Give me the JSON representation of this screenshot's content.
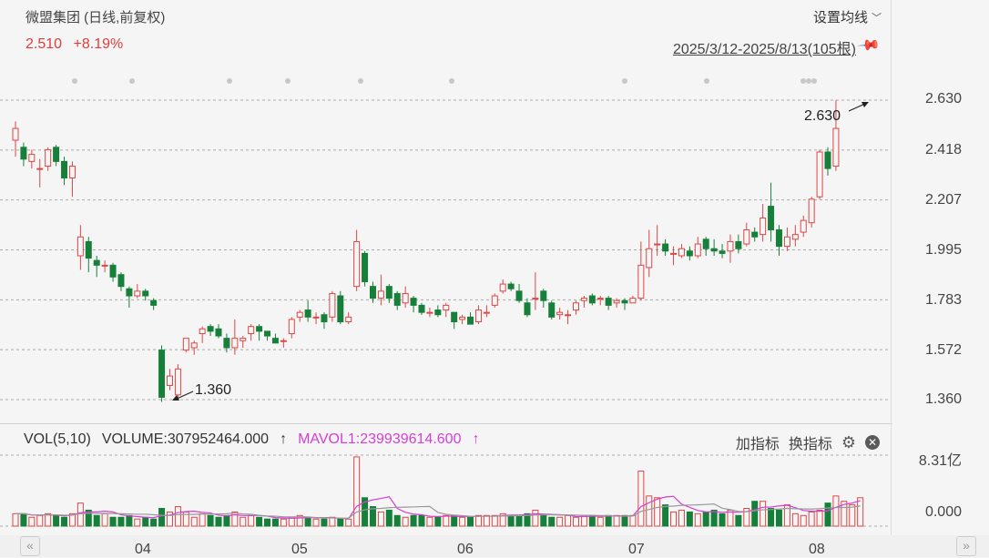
{
  "header": {
    "stock_title": "微盟集团 (日线,前复权)",
    "last_price": "2.510",
    "change_pct": "+8.19%",
    "settings_label": "设置均线",
    "range_label": "2025/3/12-2025/8/13(105根)"
  },
  "y_axis": {
    "ticks": [
      "2.630",
      "2.418",
      "2.207",
      "1.995",
      "1.783",
      "1.572",
      "1.360"
    ]
  },
  "annotations": {
    "high": "2.630",
    "low": "1.360"
  },
  "volume_panel": {
    "name": "VOL(5,10)",
    "volume": "VOLUME:307952464.000",
    "mavol": "MAVOL1:239939614.600",
    "arrow": "↑",
    "add_indicator": "加指标",
    "switch_indicator": "换指标",
    "vol_max": "8.31亿",
    "vol_min": "0.000"
  },
  "x_axis": {
    "months": [
      "04",
      "05",
      "06",
      "07",
      "08"
    ]
  },
  "colors": {
    "up": "#e04545",
    "down": "#16803a",
    "ma": "#d63fd6",
    "ma2": "#999999"
  },
  "chart_data": {
    "type": "candlestick",
    "ylim": [
      1.36,
      2.63
    ],
    "candles": [
      [
        2.46,
        2.51,
        2.39,
        2.54
      ],
      [
        2.43,
        2.38,
        2.35,
        2.45
      ],
      [
        2.37,
        2.4,
        2.34,
        2.42
      ],
      [
        2.34,
        2.34,
        2.26,
        2.38
      ],
      [
        2.35,
        2.42,
        2.33,
        2.43
      ],
      [
        2.43,
        2.37,
        2.35,
        2.44
      ],
      [
        2.37,
        2.3,
        2.27,
        2.39
      ],
      [
        2.3,
        2.35,
        2.22,
        2.37
      ],
      [
        1.97,
        2.05,
        1.91,
        2.1
      ],
      [
        2.03,
        1.96,
        1.9,
        2.05
      ],
      [
        1.95,
        1.93,
        1.88,
        1.97
      ],
      [
        1.93,
        1.93,
        1.9,
        1.95
      ],
      [
        1.93,
        1.88,
        1.86,
        1.94
      ],
      [
        1.89,
        1.84,
        1.82,
        1.9
      ],
      [
        1.83,
        1.8,
        1.75,
        1.84
      ],
      [
        1.8,
        1.82,
        1.79,
        1.85
      ],
      [
        1.82,
        1.8,
        1.78,
        1.83
      ],
      [
        1.78,
        1.76,
        1.74,
        1.79
      ],
      [
        1.57,
        1.37,
        1.35,
        1.59
      ],
      [
        1.42,
        1.46,
        1.4,
        1.49
      ],
      [
        1.38,
        1.49,
        1.36,
        1.51
      ],
      [
        1.57,
        1.62,
        1.56,
        1.62
      ],
      [
        1.58,
        1.6,
        1.55,
        1.61
      ],
      [
        1.64,
        1.66,
        1.6,
        1.67
      ],
      [
        1.67,
        1.65,
        1.63,
        1.68
      ],
      [
        1.66,
        1.63,
        1.62,
        1.68
      ],
      [
        1.62,
        1.58,
        1.56,
        1.64
      ],
      [
        1.58,
        1.62,
        1.55,
        1.7
      ],
      [
        1.61,
        1.62,
        1.58,
        1.63
      ],
      [
        1.64,
        1.67,
        1.61,
        1.68
      ],
      [
        1.67,
        1.65,
        1.61,
        1.68
      ],
      [
        1.65,
        1.63,
        1.61,
        1.65
      ],
      [
        1.62,
        1.6,
        1.6,
        1.64
      ],
      [
        1.61,
        1.61,
        1.58,
        1.62
      ],
      [
        1.64,
        1.7,
        1.62,
        1.71
      ],
      [
        1.71,
        1.73,
        1.69,
        1.74
      ],
      [
        1.74,
        1.71,
        1.69,
        1.78
      ],
      [
        1.71,
        1.71,
        1.68,
        1.73
      ],
      [
        1.72,
        1.69,
        1.66,
        1.73
      ],
      [
        1.71,
        1.81,
        1.69,
        1.82
      ],
      [
        1.8,
        1.69,
        1.68,
        1.82
      ],
      [
        1.69,
        1.71,
        1.68,
        1.73
      ],
      [
        1.84,
        2.03,
        1.82,
        2.08
      ],
      [
        1.98,
        1.86,
        1.84,
        1.99
      ],
      [
        1.84,
        1.79,
        1.77,
        1.86
      ],
      [
        1.79,
        1.82,
        1.76,
        1.89
      ],
      [
        1.84,
        1.79,
        1.77,
        1.85
      ],
      [
        1.81,
        1.76,
        1.74,
        1.82
      ],
      [
        1.77,
        1.81,
        1.75,
        1.84
      ],
      [
        1.79,
        1.76,
        1.73,
        1.8
      ],
      [
        1.76,
        1.73,
        1.72,
        1.77
      ],
      [
        1.73,
        1.73,
        1.71,
        1.75
      ],
      [
        1.74,
        1.72,
        1.71,
        1.76
      ],
      [
        1.74,
        1.76,
        1.71,
        1.77
      ],
      [
        1.73,
        1.69,
        1.66,
        1.73
      ],
      [
        1.7,
        1.71,
        1.68,
        1.72
      ],
      [
        1.71,
        1.68,
        1.68,
        1.73
      ],
      [
        1.69,
        1.74,
        1.68,
        1.76
      ],
      [
        1.73,
        1.73,
        1.71,
        1.76
      ],
      [
        1.76,
        1.8,
        1.75,
        1.81
      ],
      [
        1.82,
        1.85,
        1.81,
        1.87
      ],
      [
        1.85,
        1.83,
        1.82,
        1.86
      ],
      [
        1.82,
        1.78,
        1.77,
        1.85
      ],
      [
        1.77,
        1.72,
        1.71,
        1.79
      ],
      [
        1.79,
        1.79,
        1.74,
        1.9
      ],
      [
        1.82,
        1.78,
        1.75,
        1.83
      ],
      [
        1.77,
        1.71,
        1.7,
        1.78
      ],
      [
        1.72,
        1.73,
        1.7,
        1.75
      ],
      [
        1.72,
        1.72,
        1.68,
        1.74
      ],
      [
        1.74,
        1.77,
        1.72,
        1.78
      ],
      [
        1.78,
        1.79,
        1.75,
        1.8
      ],
      [
        1.8,
        1.77,
        1.76,
        1.81
      ],
      [
        1.79,
        1.79,
        1.76,
        1.8
      ],
      [
        1.79,
        1.76,
        1.74,
        1.8
      ],
      [
        1.77,
        1.78,
        1.75,
        1.79
      ],
      [
        1.78,
        1.77,
        1.74,
        1.79
      ],
      [
        1.77,
        1.79,
        1.77,
        1.8
      ],
      [
        1.79,
        1.93,
        1.78,
        2.03
      ],
      [
        1.92,
        2.0,
        1.88,
        2.08
      ],
      [
        2.02,
        2.02,
        1.97,
        2.1
      ],
      [
        2.02,
        1.99,
        1.97,
        2.04
      ],
      [
        1.98,
        1.98,
        1.93,
        2.01
      ],
      [
        1.97,
        2.0,
        1.96,
        2.02
      ],
      [
        1.99,
        1.97,
        1.95,
        2.01
      ],
      [
        1.97,
        2.02,
        1.96,
        2.05
      ],
      [
        2.04,
        2.0,
        1.97,
        2.05
      ],
      [
        2.0,
        1.99,
        1.97,
        2.04
      ],
      [
        1.99,
        1.98,
        1.96,
        2.02
      ],
      [
        1.99,
        2.03,
        1.94,
        2.06
      ],
      [
        2.03,
        2.0,
        1.98,
        2.06
      ],
      [
        2.02,
        2.08,
        2.01,
        2.11
      ],
      [
        2.07,
        2.05,
        2.03,
        2.09
      ],
      [
        2.06,
        2.13,
        2.03,
        2.19
      ],
      [
        2.18,
        2.08,
        2.03,
        2.28
      ],
      [
        2.08,
        2.01,
        1.97,
        2.1
      ],
      [
        2.01,
        2.05,
        1.99,
        2.09
      ],
      [
        2.04,
        2.06,
        2.01,
        2.1
      ],
      [
        2.07,
        2.12,
        2.05,
        2.14
      ],
      [
        2.11,
        2.21,
        2.09,
        2.22
      ],
      [
        2.22,
        2.41,
        2.21,
        2.42
      ],
      [
        2.41,
        2.34,
        2.31,
        2.43
      ],
      [
        2.35,
        2.51,
        2.33,
        2.63
      ]
    ],
    "volumes": [
      0.7,
      0.7,
      0.5,
      0.6,
      0.7,
      0.6,
      0.5,
      0.7,
      1.3,
      0.9,
      0.6,
      0.7,
      0.5,
      0.5,
      0.6,
      0.4,
      0.5,
      0.4,
      1.0,
      0.8,
      1.1,
      0.8,
      0.5,
      0.7,
      0.6,
      0.5,
      0.6,
      0.8,
      0.5,
      0.6,
      0.5,
      0.4,
      0.4,
      0.4,
      0.5,
      0.6,
      0.5,
      0.4,
      0.4,
      0.5,
      0.4,
      0.4,
      3.9,
      1.6,
      1.1,
      0.8,
      0.9,
      0.6,
      0.5,
      0.6,
      0.6,
      0.5,
      0.5,
      0.6,
      0.6,
      0.5,
      0.5,
      0.6,
      0.6,
      0.6,
      0.7,
      0.6,
      0.6,
      0.7,
      0.9,
      0.6,
      0.5,
      0.5,
      0.6,
      0.5,
      0.6,
      0.6,
      0.5,
      0.6,
      0.6,
      0.6,
      0.6,
      3.1,
      1.7,
      1.6,
      1.2,
      0.8,
      0.9,
      0.8,
      0.7,
      0.8,
      0.9,
      0.7,
      0.9,
      0.6,
      1.0,
      1.4,
      1.4,
      1.0,
      0.9,
      1.2,
      0.7,
      0.6,
      0.8,
      0.9,
      1.3,
      1.7,
      1.4,
      1.2,
      1.6
    ],
    "vol_max": 8.31,
    "x_months": [
      "04",
      "05",
      "06",
      "07",
      "08"
    ]
  }
}
